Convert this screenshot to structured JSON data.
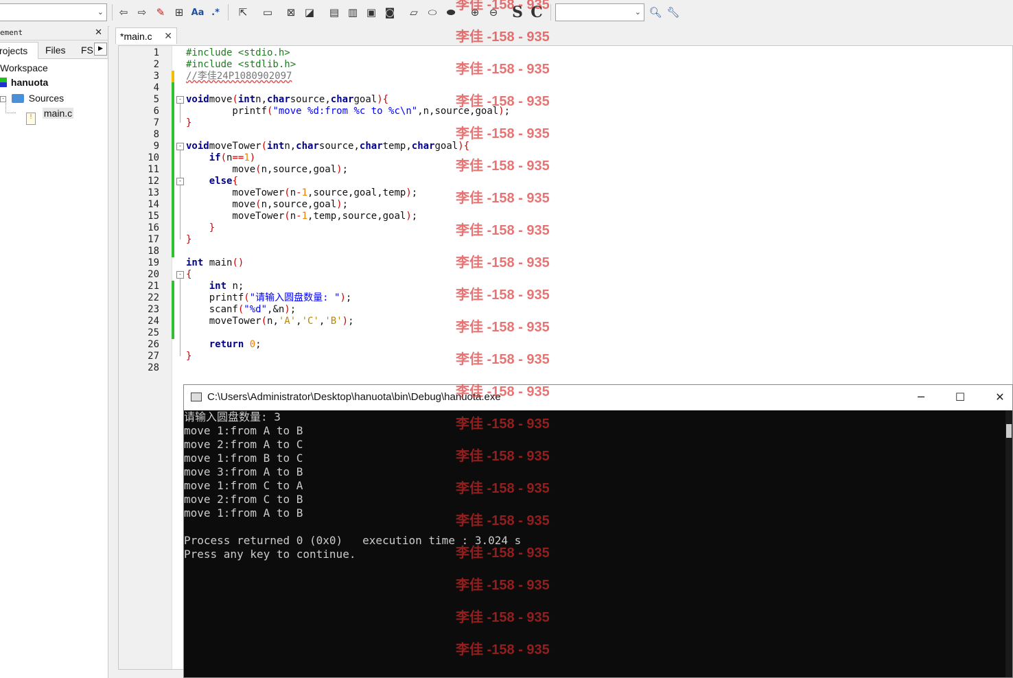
{
  "toolbar": {
    "combo_left_value": "",
    "combo_right_value": "",
    "buttons": [
      "back-icon",
      "forward-icon",
      "highlight-icon",
      "replace-icon",
      "match-case-icon",
      "regex-icon",
      "select-pointer-icon",
      "rectangle-icon",
      "grid-a-icon",
      "grid-b-icon",
      "block-a-icon",
      "block-b-icon",
      "block-c-icon",
      "block-d-icon",
      "shape-a-icon",
      "shape-b-icon",
      "shape-c-icon",
      "zoom-in-icon",
      "zoom-out-icon",
      "s-icon",
      "c-icon",
      "search-icon",
      "tool-icon"
    ],
    "s_label": "S",
    "c_label": "C"
  },
  "left_panel": {
    "title": "ement",
    "tabs": [
      "rojects",
      "Files",
      "FS"
    ],
    "tree": {
      "workspace": "Workspace",
      "project": "hanuota",
      "folder": "Sources",
      "file": "main.c"
    }
  },
  "editor": {
    "tab_label": "*main.c",
    "line_numbers": [
      "1",
      "2",
      "3",
      "4",
      "5",
      "6",
      "7",
      "8",
      "9",
      "10",
      "11",
      "12",
      "13",
      "14",
      "15",
      "16",
      "17",
      "18",
      "19",
      "20",
      "21",
      "22",
      "23",
      "24",
      "25",
      "26",
      "27",
      "28"
    ],
    "lines": [
      [
        [
          "pp",
          "#include <stdio.h>"
        ]
      ],
      [
        [
          "pp",
          "#include <stdlib.h>"
        ]
      ],
      [
        [
          "cm",
          "//李佳24P1080902097"
        ]
      ],
      [],
      [
        [
          "kw",
          "void"
        ],
        [
          "",
          "move"
        ],
        [
          "op",
          "("
        ],
        [
          "kw",
          "int"
        ],
        [
          "",
          "n,"
        ],
        [
          "kw",
          "char"
        ],
        [
          "",
          "source,"
        ],
        [
          "kw",
          "char"
        ],
        [
          "",
          "goal"
        ],
        [
          "op",
          ")"
        ],
        [
          "op",
          "{"
        ]
      ],
      [
        [
          "",
          "        printf"
        ],
        [
          "op",
          "("
        ],
        [
          "st",
          "\"move %d:from %c to %c\\n\""
        ],
        [
          "",
          ",n,source,goal"
        ],
        [
          "op",
          ")"
        ],
        [
          "",
          ";"
        ]
      ],
      [
        [
          "op",
          "}"
        ]
      ],
      [],
      [
        [
          "kw",
          "void"
        ],
        [
          "",
          "moveTower"
        ],
        [
          "op",
          "("
        ],
        [
          "kw",
          "int"
        ],
        [
          "",
          "n,"
        ],
        [
          "kw",
          "char"
        ],
        [
          "",
          "source,"
        ],
        [
          "kw",
          "char"
        ],
        [
          "",
          "temp,"
        ],
        [
          "kw",
          "char"
        ],
        [
          "",
          "goal"
        ],
        [
          "op",
          ")"
        ],
        [
          "op",
          "{"
        ]
      ],
      [
        [
          "",
          "    "
        ],
        [
          "kw",
          "if"
        ],
        [
          "op",
          "("
        ],
        [
          "",
          "n"
        ],
        [
          "op",
          "=="
        ],
        [
          "nm",
          "1"
        ],
        [
          "op",
          ")"
        ]
      ],
      [
        [
          "",
          "        move"
        ],
        [
          "op",
          "("
        ],
        [
          "",
          "n,source,goal"
        ],
        [
          "op",
          ")"
        ],
        [
          "",
          ";"
        ]
      ],
      [
        [
          "",
          "    "
        ],
        [
          "kw",
          "else"
        ],
        [
          "op",
          "{"
        ]
      ],
      [
        [
          "",
          "        moveTower"
        ],
        [
          "op",
          "("
        ],
        [
          "",
          "n"
        ],
        [
          "op",
          "-"
        ],
        [
          "nm",
          "1"
        ],
        [
          "",
          ",source,goal,temp"
        ],
        [
          "op",
          ")"
        ],
        [
          "",
          ";"
        ]
      ],
      [
        [
          "",
          "        move"
        ],
        [
          "op",
          "("
        ],
        [
          "",
          "n,source,goal"
        ],
        [
          "op",
          ")"
        ],
        [
          "",
          ";"
        ]
      ],
      [
        [
          "",
          "        moveTower"
        ],
        [
          "op",
          "("
        ],
        [
          "",
          "n"
        ],
        [
          "op",
          "-"
        ],
        [
          "nm",
          "1"
        ],
        [
          "",
          ",temp,source,goal"
        ],
        [
          "op",
          ")"
        ],
        [
          "",
          ";"
        ]
      ],
      [
        [
          "",
          "    "
        ],
        [
          "op",
          "}"
        ]
      ],
      [
        [
          "op",
          "}"
        ]
      ],
      [],
      [
        [
          "kw",
          "int"
        ],
        [
          "",
          ""
        ],
        [
          "",
          "main"
        ],
        [
          "op",
          "()"
        ]
      ],
      [
        [
          "op",
          "{"
        ]
      ],
      [
        [
          "",
          "    "
        ],
        [
          "kw",
          "int"
        ],
        [
          "",
          ""
        ],
        [
          "",
          "n;"
        ]
      ],
      [
        [
          "",
          "    printf"
        ],
        [
          "op",
          "("
        ],
        [
          "st",
          "\"请输入圆盘数量: \""
        ],
        [
          "op",
          ")"
        ],
        [
          "",
          ";"
        ]
      ],
      [
        [
          "",
          "    scanf"
        ],
        [
          "op",
          "("
        ],
        [
          "st",
          "\"%d\""
        ],
        [
          "",
          ",&n"
        ],
        [
          "op",
          ")"
        ],
        [
          "",
          ";"
        ]
      ],
      [
        [
          "",
          "    moveTower"
        ],
        [
          "op",
          "("
        ],
        [
          "",
          "n,"
        ],
        [
          "ch",
          "'A'"
        ],
        [
          "",
          ","
        ],
        [
          "ch",
          "'C'"
        ],
        [
          "",
          ","
        ],
        [
          "ch",
          "'B'"
        ],
        [
          "op",
          ")"
        ],
        [
          "",
          ";"
        ]
      ],
      [],
      [
        [
          "",
          "    "
        ],
        [
          "kw",
          "return"
        ],
        [
          "",
          ""
        ],
        [
          "nm",
          "0"
        ],
        [
          "",
          ";"
        ]
      ],
      [
        [
          "op",
          "}"
        ]
      ],
      []
    ]
  },
  "console": {
    "title": "C:\\Users\\Administrator\\Desktop\\hanuota\\bin\\Debug\\hanuota.exe",
    "minimize_label": "─",
    "maximize_label": "☐",
    "close_label": "✕",
    "lines": [
      "请输入圆盘数量: 3",
      "move 1:from A to B",
      "move 2:from A to C",
      "move 1:from B to C",
      "move 3:from A to B",
      "move 1:from C to A",
      "move 2:from C to B",
      "move 1:from A to B",
      "",
      "Process returned 0 (0x0)   execution time : 3.024 s",
      "Press any key to continue."
    ]
  },
  "watermark": {
    "text": "李佳 -158 - 935",
    "color": "#dc2828",
    "count": 21
  }
}
